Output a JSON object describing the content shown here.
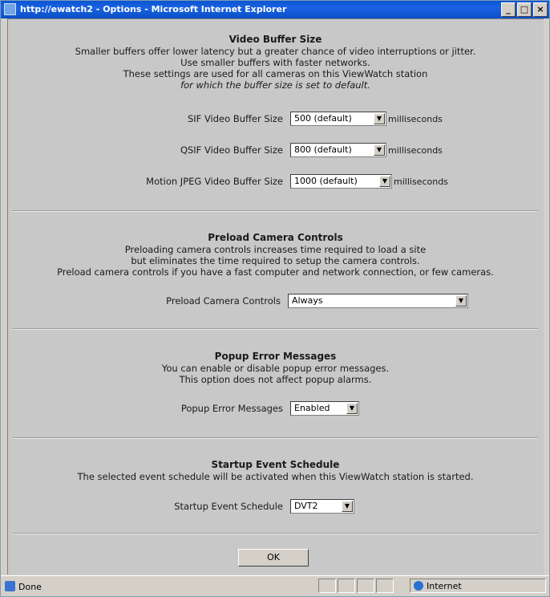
{
  "window": {
    "title": "http://ewatch2 - Options - Microsoft Internet Explorer",
    "controls": [
      "_",
      "□",
      "×"
    ]
  },
  "video_buffer": {
    "heading": "Video Buffer Size",
    "lines": [
      "Smaller buffers offer lower latency but a greater chance of video interruptions or jitter.",
      "Use smaller buffers with faster networks.",
      "These settings are used for all cameras on this ViewWatch station",
      "for which the buffer size is set to default."
    ],
    "sif": {
      "label": "SIF Video Buffer Size",
      "value": "500 (default)",
      "unit": "milliseconds"
    },
    "qsif": {
      "label": "QSIF Video Buffer Size",
      "value": "800 (default)",
      "unit": "milliseconds"
    },
    "mjpeg": {
      "label": "Motion JPEG Video Buffer Size",
      "value": "1000 (default)",
      "unit": "milliseconds"
    }
  },
  "preload": {
    "heading": "Preload Camera Controls",
    "lines": [
      "Preloading camera controls increases time required to load a site",
      "but eliminates the time required to setup the camera controls.",
      "Preload camera controls if you have a fast computer and network connection, or few cameras."
    ],
    "label": "Preload Camera Controls",
    "value": "Always"
  },
  "popup": {
    "heading": "Popup Error Messages",
    "lines": [
      "You can enable or disable popup error messages.",
      "This option does not affect popup alarms."
    ],
    "label": "Popup Error Messages",
    "value": "Enabled"
  },
  "startup": {
    "heading": "Startup Event Schedule",
    "lines": [
      "The selected event schedule will be activated when this ViewWatch station is started."
    ],
    "label": "Startup Event Schedule",
    "value": "DVT2"
  },
  "ok_label": "OK",
  "status": {
    "done": "Done",
    "zone": "Internet"
  },
  "icons": {
    "dropdown": "▼"
  }
}
